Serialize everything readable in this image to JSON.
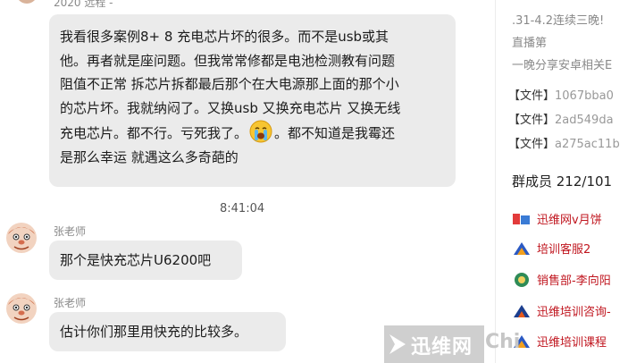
{
  "chat": {
    "top_sender": "2020 远程 -",
    "message1_lines": [
      "我看很多案例8+ 8 充电芯片坏的很多。而不是usb或其",
      "他。再者就是座问题。但我常常修都是电池检测教有问题",
      "阻值不正常 拆芯片拆都最后那个在大电源那上面的那个小",
      "的芯片坏。我就纳闷了。又换usb 又换充电芯片 又换无线",
      "充电芯片。都不行。亏死我了。",
      "。都不知道是我霉还",
      "是那么幸运 就遇这么多奇葩的"
    ],
    "timestamp": "8:41:04",
    "message2": {
      "sender": "张老师",
      "text": "那个是快充芯片U6200吧"
    },
    "message3": {
      "sender": "张老师",
      "text": "估计你们那里用快充的比较多。"
    }
  },
  "panel": {
    "announcement_lines": [
      ".31-4.2连续三晚!",
      "直播第",
      "一晚分享安卓相关E"
    ],
    "files": [
      {
        "tag": "【文件】",
        "name": "1067bba0"
      },
      {
        "tag": "【文件】",
        "name": "2ad549da"
      },
      {
        "tag": "【文件】",
        "name": "a275ac11b"
      }
    ],
    "members_title": "群成员 212/101",
    "members": [
      {
        "name": "迅维网v月饼"
      },
      {
        "name": "培训客服2"
      },
      {
        "name": "销售部-李向阳"
      },
      {
        "name": "迅维培训咨询-"
      },
      {
        "name": "迅维培训课程"
      }
    ]
  },
  "watermark": {
    "text": "迅维网",
    "latin": "Chi"
  },
  "colors": {
    "bubble": "#ebebeb",
    "member_red": "#c0161f"
  }
}
